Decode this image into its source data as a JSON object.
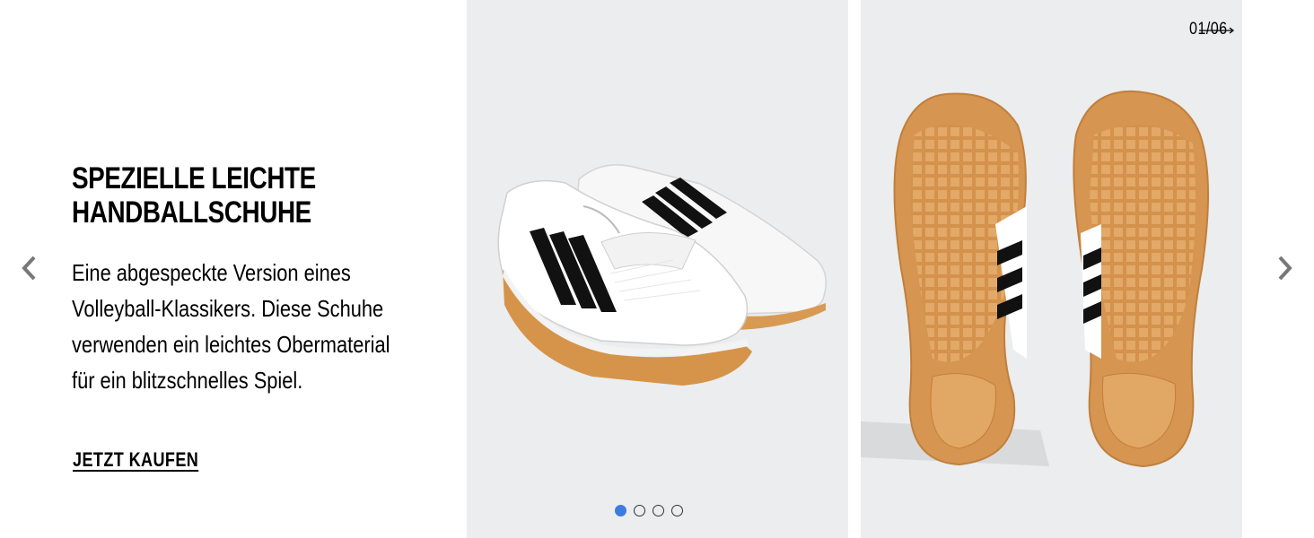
{
  "hero": {
    "title_line1": "SPEZIELLE LEICHTE",
    "title_line2": "HANDBALLSCHUHE",
    "description_lines": [
      "Eine abgespeckte Version eines",
      "Volleyball-Klassikers. Diese Schuhe",
      "verwenden ein leichtes Obermaterial",
      "für ein blitzschnelles Spiel."
    ],
    "cta_label": "JETZT KAUFEN"
  },
  "carousel": {
    "counter": "01/06",
    "dots": [
      true,
      false,
      false,
      false
    ],
    "accent_color": "#3b7ce0",
    "panel_background": "#ebedef",
    "images": [
      "white-sneakers-black-stripes-pair",
      "gum-sole-bottom-view"
    ]
  },
  "icons": {
    "prev": "chevron-left-icon",
    "next": "chevron-right-icon",
    "counter_arrow": "long-arrow-right-icon"
  }
}
